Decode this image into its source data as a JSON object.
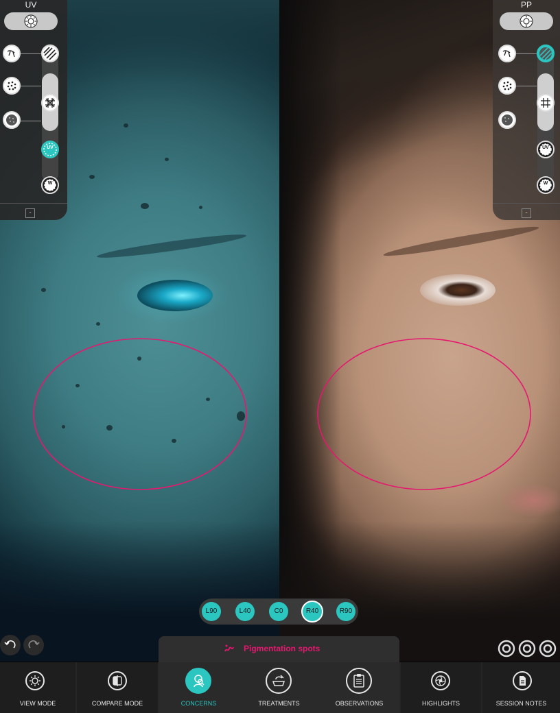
{
  "app": {
    "accent_color": "#2cc6c0",
    "highlight_color": "#e5186f"
  },
  "left_panel": {
    "title": "UV",
    "mode_icon": "sun-gear-icon",
    "icons": [
      "texture-icon",
      "pores-icon",
      "spots-icon",
      "lines-icon",
      "grid-icon",
      "uv-icon",
      "white-light-icon"
    ],
    "uv_label": "UV",
    "w_label": "W",
    "collapse_label": "-"
  },
  "right_panel": {
    "title": "PP",
    "uv_label": "UV",
    "w_label": "W",
    "collapse_label": "-"
  },
  "angles": {
    "options": [
      "L90",
      "L40",
      "C0",
      "R40",
      "R90"
    ],
    "selected": "R40"
  },
  "concern": {
    "label": "Pigmentation spots"
  },
  "nav": {
    "view_mode": "VIEW MODE",
    "compare_mode": "COMPARE MODE",
    "concerns": "CONCERNS",
    "treatments": "TREATMENTS",
    "observations": "OBSERVATIONS",
    "highlights": "HIGHLIGHTS",
    "session_notes": "SESSION NOTES",
    "active": "CONCERNS"
  }
}
